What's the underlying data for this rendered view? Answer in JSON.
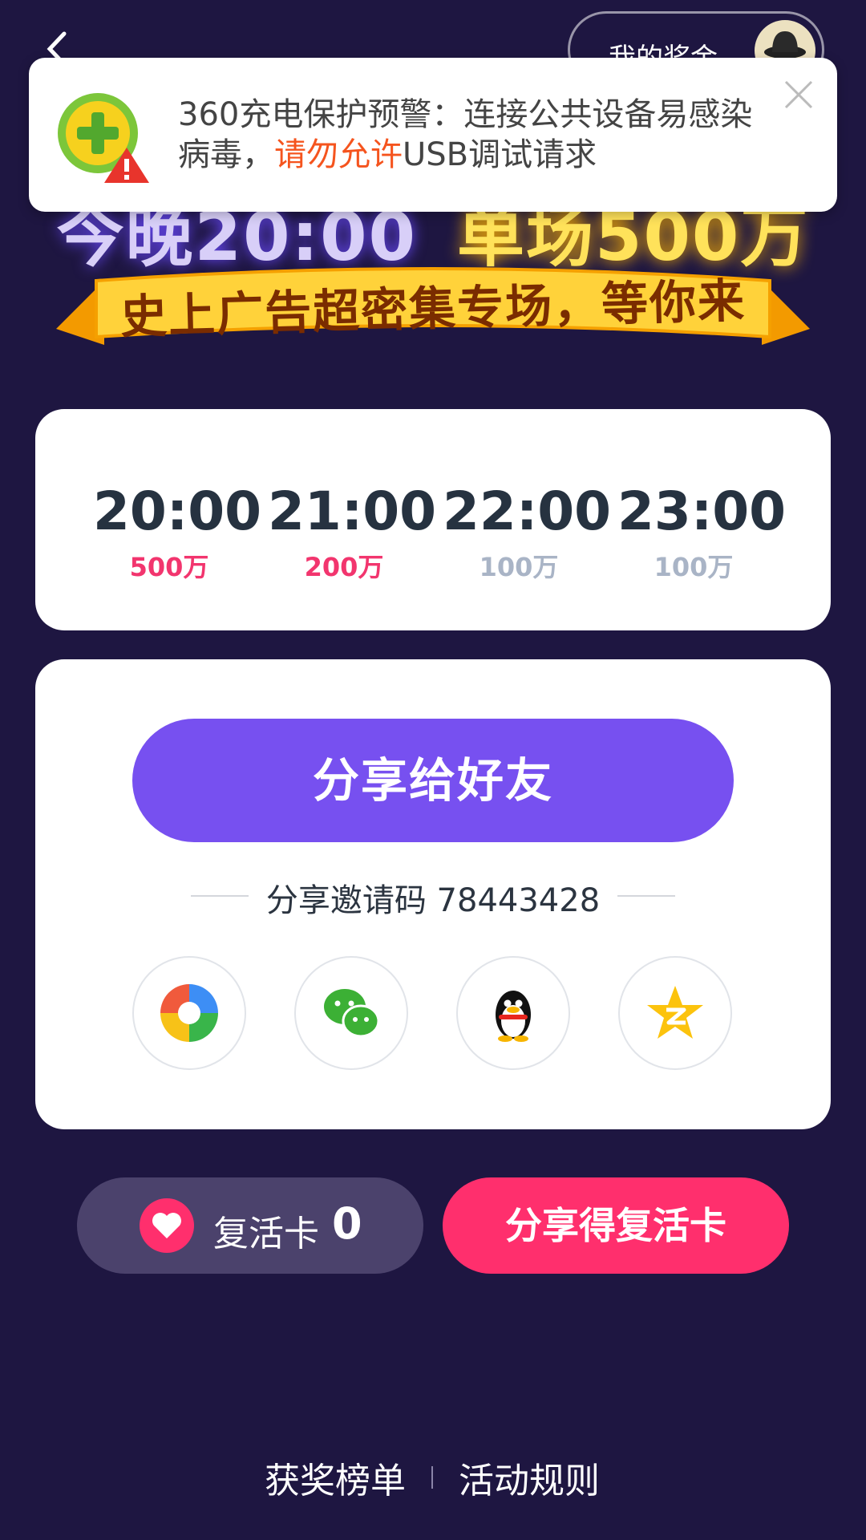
{
  "header": {
    "prize_label": "我的奖金"
  },
  "banner": {
    "headline_left": "今晚20:00",
    "headline_right": "单场500万",
    "ribbon_text": "史上广告超密集专场，等你来"
  },
  "notification": {
    "text_part1": "360充电保护预警：连接公共设备易感染病毒，",
    "text_highlight": "请勿允许",
    "text_part2": "USB调试请求"
  },
  "schedule": [
    {
      "time": "20:00",
      "amount": "500万"
    },
    {
      "time": "21:00",
      "amount": "200万"
    },
    {
      "time": "22:00",
      "amount": "100万"
    },
    {
      "time": "23:00",
      "amount": "100万"
    }
  ],
  "share": {
    "button_label": "分享给好友",
    "invite_text": "分享邀请码 78443428",
    "targets": [
      "moments-icon",
      "wechat-icon",
      "qq-icon",
      "qzone-icon"
    ]
  },
  "revive": {
    "label": "复活卡",
    "count": "0",
    "share_button": "分享得复活卡"
  },
  "footer": {
    "leaderboard": "获奖榜单",
    "rules": "活动规则"
  },
  "colors": {
    "background": "#1e1641",
    "accent_purple": "#7750f0",
    "accent_pink": "#ff2f6d",
    "notif_highlight": "#f5541e"
  }
}
